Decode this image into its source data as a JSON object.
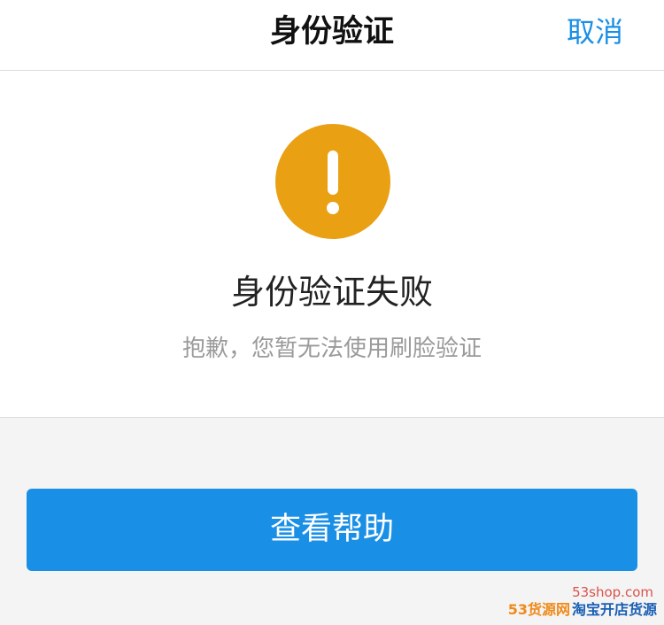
{
  "header": {
    "title": "身份验证",
    "cancel_label": "取消"
  },
  "result": {
    "icon": "warning-icon",
    "icon_color": "#e9a013",
    "title": "身份验证失败",
    "message": "抱歉，您暂无法使用刷脸验证"
  },
  "actions": {
    "help_label": "查看帮助",
    "help_color": "#1a8fe6"
  },
  "watermark": {
    "url": "53shop.com",
    "brand": "53货源网",
    "slogan": "淘宝开店货源"
  }
}
